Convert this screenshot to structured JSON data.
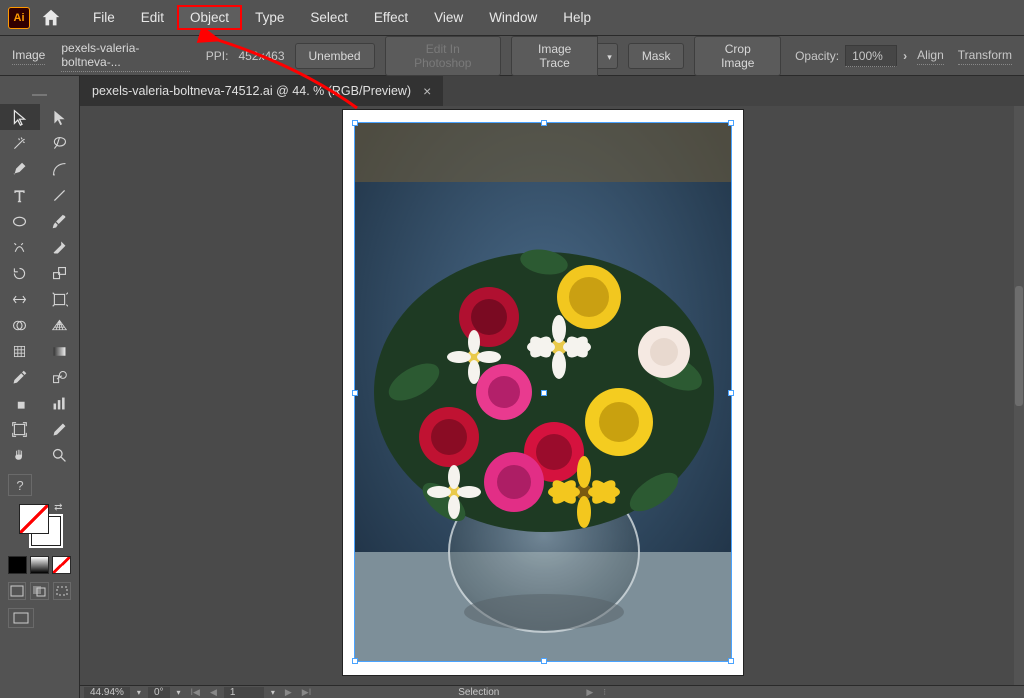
{
  "menubar": {
    "items": [
      "File",
      "Edit",
      "Object",
      "Type",
      "Select",
      "Effect",
      "View",
      "Window",
      "Help"
    ],
    "highlighted_index": 2
  },
  "controlbar": {
    "context_label": "Image",
    "file_caption": "pexels-valeria-boltneva-...",
    "ppi_label": "PPI:",
    "ppi_value": "452x463",
    "buttons": {
      "unembed": "Unembed",
      "edit_in_ps": "Edit In Photoshop",
      "image_trace": "Image Trace",
      "mask": "Mask",
      "crop_image": "Crop Image"
    },
    "opacity": {
      "label": "Opacity:",
      "value": "100%"
    },
    "right": {
      "align": "Align",
      "transform": "Transform"
    }
  },
  "document_tab": {
    "title": "pexels-valeria-boltneva-74512.ai @ 44.  % (RGB/Preview)"
  },
  "toolbox": {
    "title": "",
    "question": "?"
  },
  "statusbar": {
    "zoom": "44.94%",
    "rotation": "0°",
    "artboard": "1",
    "selection_label": "Selection"
  },
  "icons": {
    "home": "home-icon",
    "chevron_down": "chevron-down-icon",
    "chevron_right": "chevron-right-icon",
    "close": "close-icon"
  },
  "colors": {
    "highlight_border": "#ff0000",
    "selection_outline": "#4aa3ff"
  }
}
